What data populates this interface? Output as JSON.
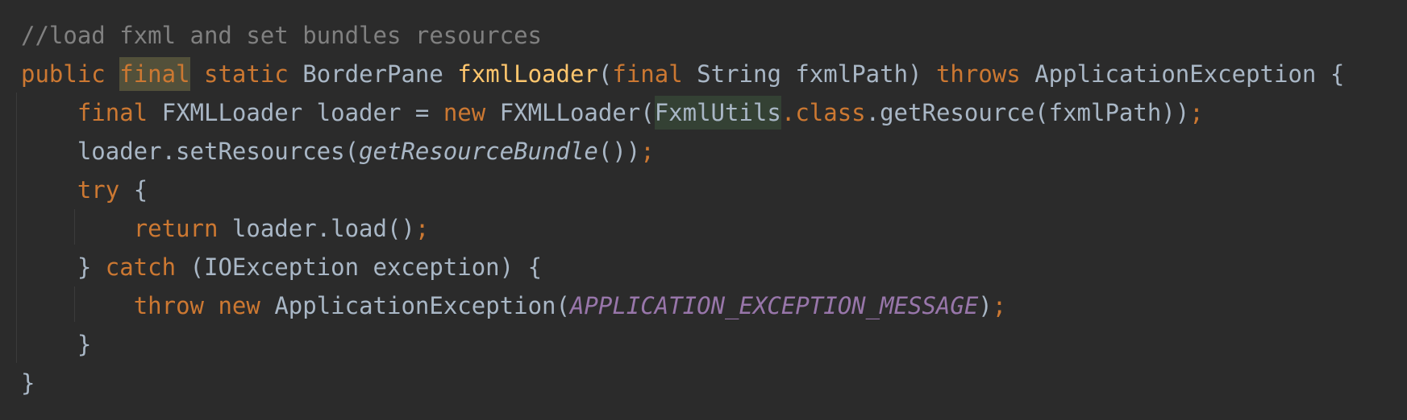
{
  "theme": {
    "background": "#2b2b2b",
    "default_text": "#a9b7c6",
    "comment": "#808080",
    "keyword": "#cc7832",
    "method_declaration": "#ffc66d",
    "constant": "#9876aa",
    "usage_highlight": "#52503a",
    "class_highlight": "#344134"
  },
  "code": {
    "line1": {
      "comment": "//load fxml and set bundles resources"
    },
    "line2": {
      "kw_public": "public",
      "sp1": " ",
      "kw_final": "final",
      "sp2": " ",
      "kw_static": "static",
      "type": " BorderPane ",
      "method": "fxmlLoader",
      "open": "(",
      "kw_final2": "final",
      "params": " String fxmlPath) ",
      "kw_throws": "throws",
      "tail": " ApplicationException {"
    },
    "line3": {
      "indent": "    ",
      "kw_final": "final",
      "decl": " FXMLLoader loader = ",
      "kw_new": "new",
      "ctor": " FXMLLoader(",
      "cls": "FxmlUtils",
      "dot": ".",
      "kw_class": "class",
      "call": ".getResource(fxmlPath))",
      "semi": ";"
    },
    "line4": {
      "indent": "    ",
      "pre": "loader.setResources(",
      "static_call": "getResourceBundle",
      "post": "())",
      "semi": ";"
    },
    "line5": {
      "indent": "    ",
      "kw_try": "try",
      "brace": " {"
    },
    "line6": {
      "indent": "        ",
      "kw_return": "return",
      "call": " loader.load()",
      "semi": ";"
    },
    "line7": {
      "indent": "    ",
      "brace": "} ",
      "kw_catch": "catch",
      "rest": " (IOException exception) {"
    },
    "line8": {
      "indent": "        ",
      "kw_throw": "throw",
      "sp": " ",
      "kw_new": "new",
      "ctor": " ApplicationException(",
      "constant": "APPLICATION_EXCEPTION_MESSAGE",
      "close": ")",
      "semi": ";"
    },
    "line9": {
      "indent": "    ",
      "brace": "}"
    },
    "line10": {
      "brace": "}"
    }
  }
}
